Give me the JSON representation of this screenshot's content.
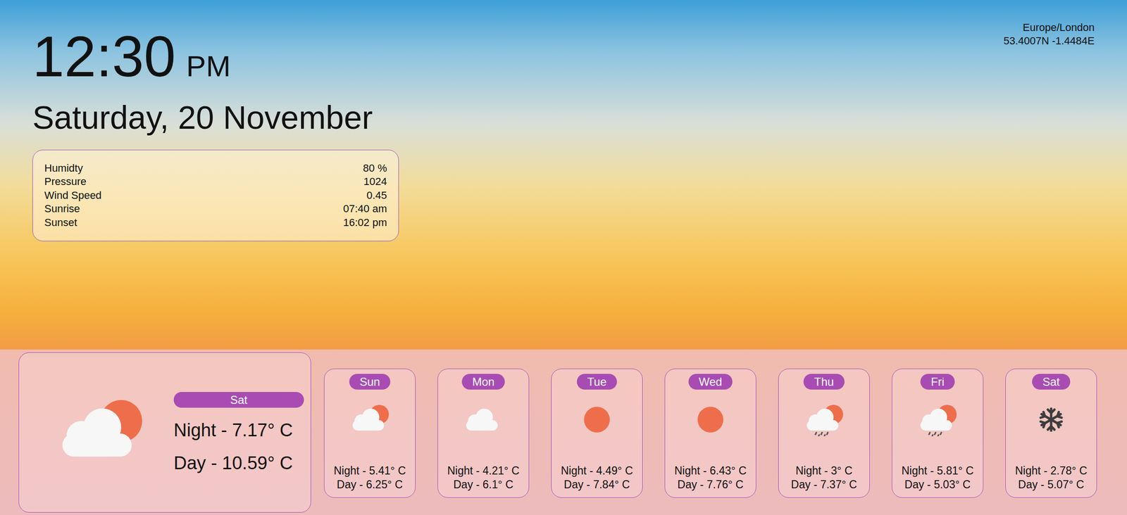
{
  "clock": {
    "time": "12:30",
    "meridiem": "PM",
    "date": "Saturday, 20 November"
  },
  "location": {
    "timezone": "Europe/London",
    "coordinates": "53.4007N -1.4484E"
  },
  "details": [
    {
      "label": "Humidty",
      "value": "80 %"
    },
    {
      "label": "Pressure",
      "value": "1024"
    },
    {
      "label": "Wind Speed",
      "value": "0.45"
    },
    {
      "label": "Sunrise",
      "value": "07:40 am"
    },
    {
      "label": "Sunset",
      "value": "16:02 pm"
    }
  ],
  "today": {
    "day": "Sat",
    "night": "Night - 7.17° C",
    "daytime": "Day - 10.59° C",
    "kind": "partly-cloudy"
  },
  "forecast": [
    {
      "day": "Sun",
      "night": "Night - 5.41° C",
      "daytime": "Day - 6.25° C",
      "kind": "partly-cloudy"
    },
    {
      "day": "Mon",
      "night": "Night - 4.21° C",
      "daytime": "Day - 6.1° C",
      "kind": "cloudy"
    },
    {
      "day": "Tue",
      "night": "Night - 4.49° C",
      "daytime": "Day - 7.84° C",
      "kind": "sunny"
    },
    {
      "day": "Wed",
      "night": "Night - 6.43° C",
      "daytime": "Day - 7.76° C",
      "kind": "sunny"
    },
    {
      "day": "Thu",
      "night": "Night - 3° C",
      "daytime": "Day - 7.37° C",
      "kind": "rain"
    },
    {
      "day": "Fri",
      "night": "Night - 5.81° C",
      "daytime": "Day - 5.03° C",
      "kind": "rain"
    },
    {
      "day": "Sat",
      "night": "Night - 2.78° C",
      "daytime": "Day - 5.07° C",
      "kind": "snow"
    }
  ]
}
